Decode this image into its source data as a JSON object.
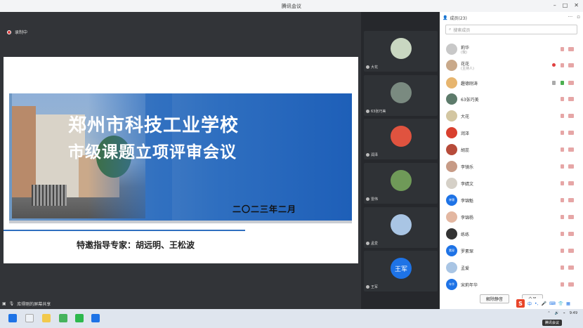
{
  "window": {
    "title": "腾讯会议"
  },
  "recording": {
    "label": "录制中"
  },
  "slide": {
    "title_line1": "郑州市科技工业学校",
    "title_line2": "市级课题立项评审会议",
    "date": "二〇二三年二月",
    "experts": "特邀指导专家：胡远明、王松波"
  },
  "screen_share": {
    "label": "库得刚的屏幕共享"
  },
  "tiles": [
    {
      "name": "大花",
      "avatar_text": "",
      "color": "#c9d7c1"
    },
    {
      "name": "63张巧美",
      "avatar_text": "",
      "color": "#7a8a80"
    },
    {
      "name": "润泽",
      "avatar_text": "",
      "color": "#e0533f"
    },
    {
      "name": "雷伟",
      "avatar_text": "",
      "color": "#6f9a58"
    },
    {
      "name": "孟爱",
      "avatar_text": "",
      "color": "#a9c5e4"
    },
    {
      "name": "王军",
      "avatar_text": "王军",
      "color": "#1e73e6"
    }
  ],
  "panel": {
    "header": "成员(23)",
    "search_placeholder": "搜索成员",
    "unmute_all": "解除静音",
    "more": "全员"
  },
  "members": [
    {
      "name": "莉华",
      "role": "(我)",
      "avatar_text": "",
      "color": "#c8c8c8"
    },
    {
      "name": "花花",
      "role": "(主持人)",
      "avatar_text": "",
      "color": "#c9a98a"
    },
    {
      "name": "趣德刚涛",
      "role": "",
      "avatar_text": "",
      "color": "#e7b56e"
    },
    {
      "name": "63张巧美",
      "role": "",
      "avatar_text": "",
      "color": "#5d7b6b"
    },
    {
      "name": "大花",
      "role": "",
      "avatar_text": "",
      "color": "#d3c6a1"
    },
    {
      "name": "润泽",
      "role": "",
      "avatar_text": "",
      "color": "#d9402e"
    },
    {
      "name": "胡蕊",
      "role": "",
      "avatar_text": "",
      "color": "#b74b3a"
    },
    {
      "name": "李镜乐",
      "role": "",
      "avatar_text": "",
      "color": "#c79b86"
    },
    {
      "name": "李婧文",
      "role": "",
      "avatar_text": "",
      "color": "#d5d0c7"
    },
    {
      "name": "李锦魁",
      "role": "",
      "avatar_text": "李锦",
      "color": "#1e73e6"
    },
    {
      "name": "李锦杨",
      "role": "",
      "avatar_text": "",
      "color": "#e3b7a1"
    },
    {
      "name": "练练",
      "role": "",
      "avatar_text": "",
      "color": "#333333"
    },
    {
      "name": "罗素琛",
      "role": "",
      "avatar_text": "素琛",
      "color": "#1e73e6"
    },
    {
      "name": "孟爱",
      "role": "",
      "avatar_text": "",
      "color": "#a9c5e4"
    },
    {
      "name": "宋莉年华",
      "role": "",
      "avatar_text": "年华",
      "color": "#1e73e6"
    }
  ],
  "ime": {
    "logo": "S",
    "mode": "中"
  },
  "taskbar": {
    "tooltip": "腾讯会议",
    "time": "9:49"
  }
}
